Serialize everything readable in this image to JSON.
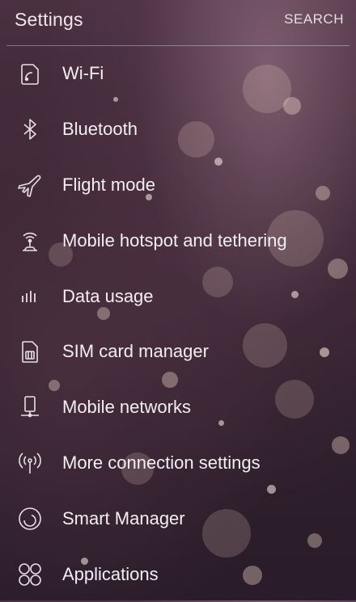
{
  "header": {
    "title": "Settings",
    "search_label": "SEARCH"
  },
  "settings_items": [
    {
      "label": "Wi-Fi",
      "icon": "wifi-icon"
    },
    {
      "label": "Bluetooth",
      "icon": "bluetooth-icon"
    },
    {
      "label": "Flight mode",
      "icon": "airplane-icon"
    },
    {
      "label": "Mobile hotspot and tethering",
      "icon": "hotspot-icon"
    },
    {
      "label": "Data usage",
      "icon": "data-usage-icon"
    },
    {
      "label": "SIM card manager",
      "icon": "sim-card-icon"
    },
    {
      "label": "Mobile networks",
      "icon": "mobile-networks-icon"
    },
    {
      "label": "More connection settings",
      "icon": "antenna-icon"
    },
    {
      "label": "Smart Manager",
      "icon": "smart-manager-icon"
    },
    {
      "label": "Applications",
      "icon": "applications-icon"
    }
  ],
  "colors": {
    "text": "#f3eef1",
    "divider": "rgba(255,255,255,0.35)",
    "background": "#3a2432"
  }
}
